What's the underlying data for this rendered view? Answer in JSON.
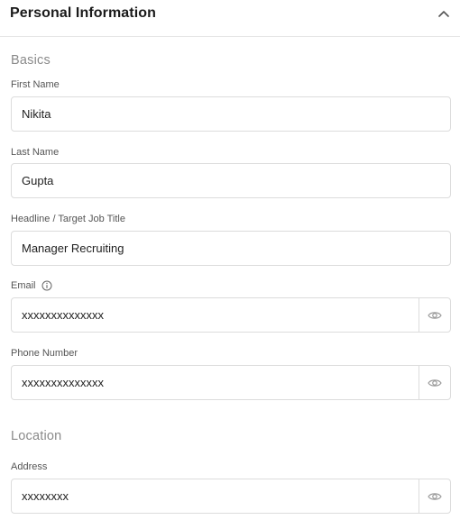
{
  "header": {
    "title": "Personal Information",
    "collapse_icon": "chevron-up-icon"
  },
  "sections": {
    "basics": {
      "title": "Basics"
    },
    "location": {
      "title": "Location"
    }
  },
  "fields": {
    "first_name": {
      "label": "First Name",
      "value": "Nikita"
    },
    "last_name": {
      "label": "Last Name",
      "value": "Gupta"
    },
    "headline": {
      "label": "Headline / Target Job Title",
      "value": "Manager Recruiting"
    },
    "email": {
      "label": "Email",
      "value": "xxxxxxxxxxxxxx",
      "info_icon": "info-icon",
      "toggle_icon": "eye-icon"
    },
    "phone": {
      "label": "Phone Number",
      "value": "xxxxxxxxxxxxxx",
      "toggle_icon": "eye-icon"
    },
    "address": {
      "label": "Address",
      "value": "xxxxxxxx",
      "toggle_icon": "eye-icon"
    }
  },
  "colors": {
    "border": "#dcdcdc",
    "section_title": "#8a8a8a",
    "label": "#555555"
  }
}
